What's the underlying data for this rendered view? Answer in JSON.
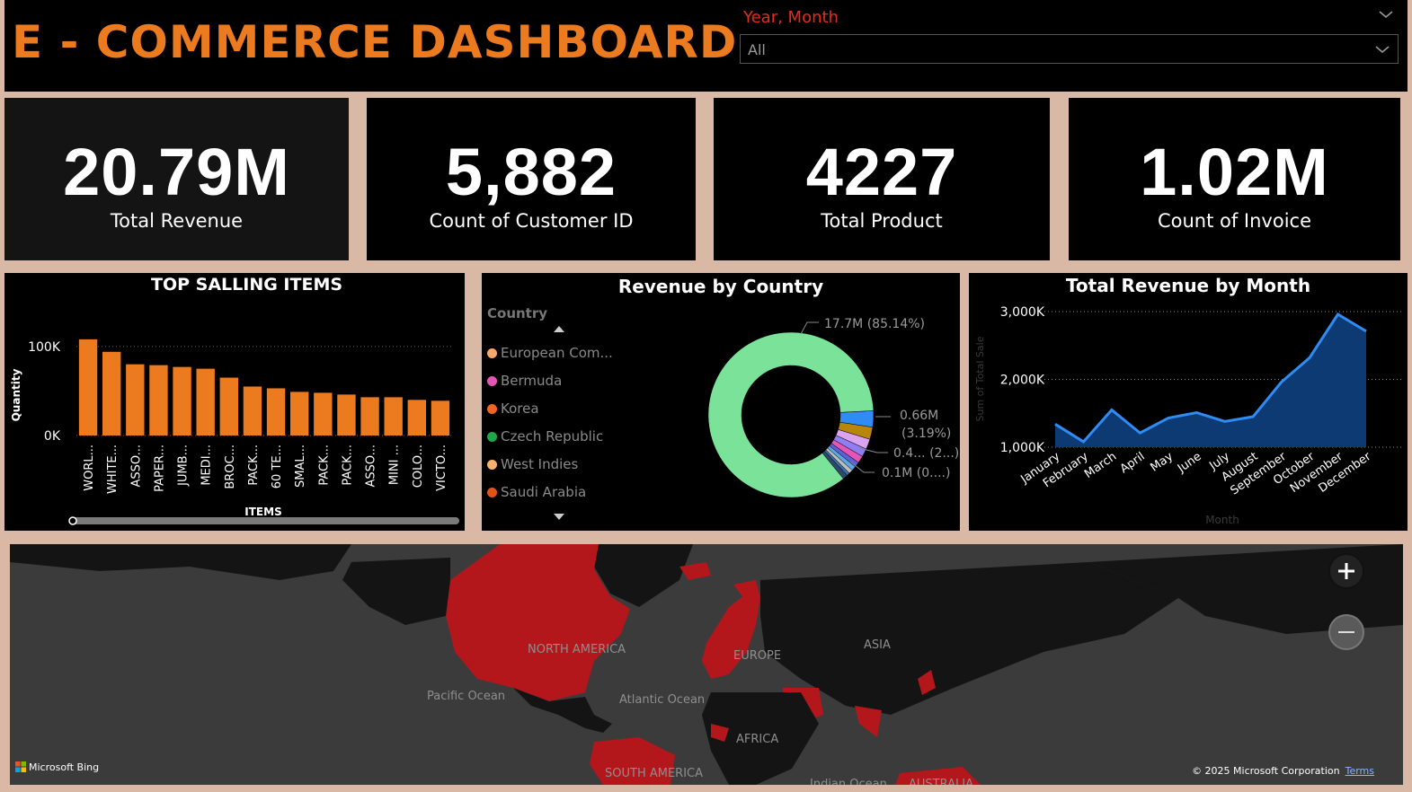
{
  "header": {
    "title": "E - COMMERCE DASHBOARD",
    "slicer_label": "Year, Month",
    "slicer_value": "All"
  },
  "kpis": [
    {
      "value": "20.79M",
      "label": "Total Revenue"
    },
    {
      "value": "5,882",
      "label": "Count of Customer ID"
    },
    {
      "value": "4227",
      "label": "Total Product"
    },
    {
      "value": "1.02M",
      "label": "Count of Invoice"
    }
  ],
  "colors": {
    "accent_orange": "#ec7a1e",
    "slicer_red": "#e8291c",
    "donut_main": "#7be29a",
    "line_blue": "#2f8cf5",
    "area_fill": "#0d3a73",
    "map_red": "#b3161b"
  },
  "chart_data": [
    {
      "type": "bar",
      "title": "TOP SALLING ITEMS",
      "xlabel": "ITEMS",
      "ylabel": "Quantity",
      "yticks": [
        "100K",
        "0K"
      ],
      "ylim": [
        0,
        120000
      ],
      "categories": [
        "WORL...",
        "WHITE...",
        "ASSO...",
        "PAPER...",
        "JUMB...",
        "MEDI...",
        "BROC...",
        "PACK...",
        "60 TE...",
        "SMAL...",
        "PACK...",
        "PACK...",
        "ASSO...",
        "MINI ...",
        "COLO...",
        "VICTO..."
      ],
      "values": [
        108000,
        94000,
        80000,
        79000,
        77000,
        75000,
        65000,
        55000,
        53000,
        49000,
        48000,
        46000,
        43000,
        43000,
        40000,
        39000
      ]
    },
    {
      "type": "pie",
      "title": "Revenue by Country",
      "legend_title": "Country",
      "legend": [
        {
          "name": "European Com...",
          "color": "#f6a86b"
        },
        {
          "name": "Bermuda",
          "color": "#e356b5"
        },
        {
          "name": "Korea",
          "color": "#f0651f"
        },
        {
          "name": "Czech Republic",
          "color": "#1fa84a"
        },
        {
          "name": "West Indies",
          "color": "#f6b06f"
        },
        {
          "name": "Saudi Arabia",
          "color": "#e2531a"
        }
      ],
      "data_labels": [
        "17.7M (85.14%)",
        "0.66M",
        "(3.19%)",
        "0.4... (2...)",
        "0.1M (0....)"
      ],
      "slices": [
        {
          "value": 85.14,
          "color": "#7be29a"
        },
        {
          "value": 3.19,
          "color": "#2f8cf5"
        },
        {
          "value": 2.4,
          "color": "#b8860b"
        },
        {
          "value": 2.0,
          "color": "#d9a3f0"
        },
        {
          "value": 1.6,
          "color": "#8f7ef2"
        },
        {
          "value": 1.4,
          "color": "#e356b5"
        },
        {
          "value": 1.0,
          "color": "#5f5fd6"
        },
        {
          "value": 0.9,
          "color": "#5aa9e6"
        },
        {
          "value": 0.8,
          "color": "#bdbdbd"
        },
        {
          "value": 0.6,
          "color": "#3b6fa8"
        },
        {
          "value": 0.97,
          "color": "#2e4a6b"
        }
      ]
    },
    {
      "type": "area",
      "title": "Total Revenue by Month",
      "xlabel": "Month",
      "ylabel": "Sum of Total Sale",
      "yticks": [
        "3,000K",
        "2,000K",
        "1,000K"
      ],
      "ylim": [
        1000,
        3000
      ],
      "categories": [
        "January",
        "February",
        "March",
        "April",
        "May",
        "June",
        "July",
        "August",
        "September",
        "October",
        "November",
        "December"
      ],
      "values": [
        1340,
        1080,
        1550,
        1210,
        1430,
        1510,
        1380,
        1450,
        1960,
        2320,
        2960,
        2710
      ]
    }
  ],
  "map": {
    "labels": [
      {
        "text": "NORTH AMERICA"
      },
      {
        "text": "EUROPE"
      },
      {
        "text": "ASIA"
      },
      {
        "text": "Pacific Ocean"
      },
      {
        "text": "Atlantic Ocean"
      },
      {
        "text": "AFRICA"
      },
      {
        "text": "SOUTH AMERICA"
      },
      {
        "text": "Indian Ocean"
      },
      {
        "text": "AUSTRALIA"
      }
    ],
    "attribution": "Microsoft Bing",
    "copyright": "© 2025 Microsoft Corporation",
    "terms": "Terms",
    "zoom_in": "+",
    "zoom_out": "−"
  }
}
